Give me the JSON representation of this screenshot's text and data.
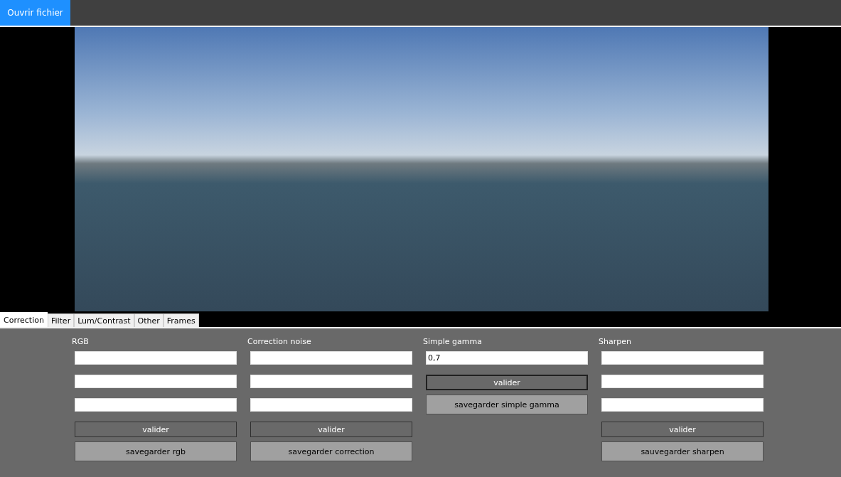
{
  "toolbar": {
    "open_button": "Ouvrir fichier"
  },
  "tabs": [
    {
      "label": "Correction",
      "selected": true
    },
    {
      "label": "Filter",
      "selected": false
    },
    {
      "label": "Lum/Contrast",
      "selected": false
    },
    {
      "label": "Other",
      "selected": false
    },
    {
      "label": "Frames",
      "selected": false
    }
  ],
  "groups": [
    {
      "title": "RGB",
      "items": [
        {
          "kind": "field",
          "value": ""
        },
        {
          "kind": "field",
          "value": ""
        },
        {
          "kind": "field",
          "value": ""
        },
        {
          "kind": "validate",
          "label": "valider",
          "focused": false
        },
        {
          "kind": "save",
          "label": "savegarder rgb"
        }
      ]
    },
    {
      "title": "Correction noise",
      "items": [
        {
          "kind": "field",
          "value": ""
        },
        {
          "kind": "field",
          "value": ""
        },
        {
          "kind": "field",
          "value": ""
        },
        {
          "kind": "validate",
          "label": "valider",
          "focused": false
        },
        {
          "kind": "save",
          "label": "savegarder correction"
        }
      ]
    },
    {
      "title": "Simple gamma",
      "items": [
        {
          "kind": "field",
          "value": "0,7"
        },
        {
          "kind": "validate",
          "label": "valider",
          "focused": true
        },
        {
          "kind": "save",
          "label": "savegarder simple gamma"
        }
      ]
    },
    {
      "title": "Sharpen",
      "items": [
        {
          "kind": "field",
          "value": ""
        },
        {
          "kind": "field",
          "value": ""
        },
        {
          "kind": "field",
          "value": ""
        },
        {
          "kind": "validate",
          "label": "valider",
          "focused": false
        },
        {
          "kind": "save",
          "label": "sauvegarder sharpen"
        }
      ]
    }
  ]
}
